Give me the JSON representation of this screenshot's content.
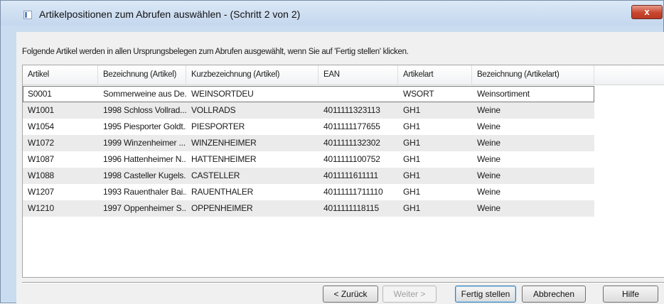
{
  "window": {
    "title": "Artikelpositionen zum Abrufen auswählen -  (Schritt 2 von 2)",
    "close_label": "x"
  },
  "instruction": "Folgende Artikel werden in allen Ursprungsbelegen zum Abrufen ausgewählt, wenn Sie auf 'Fertig stellen' klicken.",
  "table": {
    "columns": [
      "Artikel",
      "Bezeichnung (Artikel)",
      "Kurzbezeichnung (Artikel)",
      "EAN",
      "Artikelart",
      "Bezeichnung (Artikelart)"
    ],
    "rows": [
      [
        "S0001",
        "Sommerweine aus De...",
        "WEINSORTDEU",
        "",
        "WSORT",
        "Weinsortiment"
      ],
      [
        "W1001",
        "1998 Schloss Vollrad...",
        "VOLLRADS",
        "4011111323113",
        "GH1",
        "Weine"
      ],
      [
        "W1054",
        "1995 Piesporter Goldt...",
        "PIESPORTER",
        "4011111177655",
        "GH1",
        "Weine"
      ],
      [
        "W1072",
        "1999 Winzenheimer ...",
        "WINZENHEIMER",
        "4011111132302",
        "GH1",
        "Weine"
      ],
      [
        "W1087",
        "1996 Hattenheimer N...",
        "HATTENHEIMER",
        "4011111100752",
        "GH1",
        "Weine"
      ],
      [
        "W1088",
        "1998 Casteller Kugels...",
        "CASTELLER",
        "4011111611111",
        "GH1",
        "Weine"
      ],
      [
        "W1207",
        "1993 Rauenthaler Bai...",
        "RAUENTHALER",
        "40111111711110",
        "GH1",
        "Weine"
      ],
      [
        "W1210",
        "1997 Oppenheimer S...",
        "OPPENHEIMER",
        "4011111118115",
        "GH1",
        "Weine"
      ]
    ]
  },
  "buttons": {
    "back": "< Zurück",
    "next": "Weiter >",
    "finish": "Fertig stellen",
    "cancel": "Abbrechen",
    "help": "Hilfe"
  }
}
